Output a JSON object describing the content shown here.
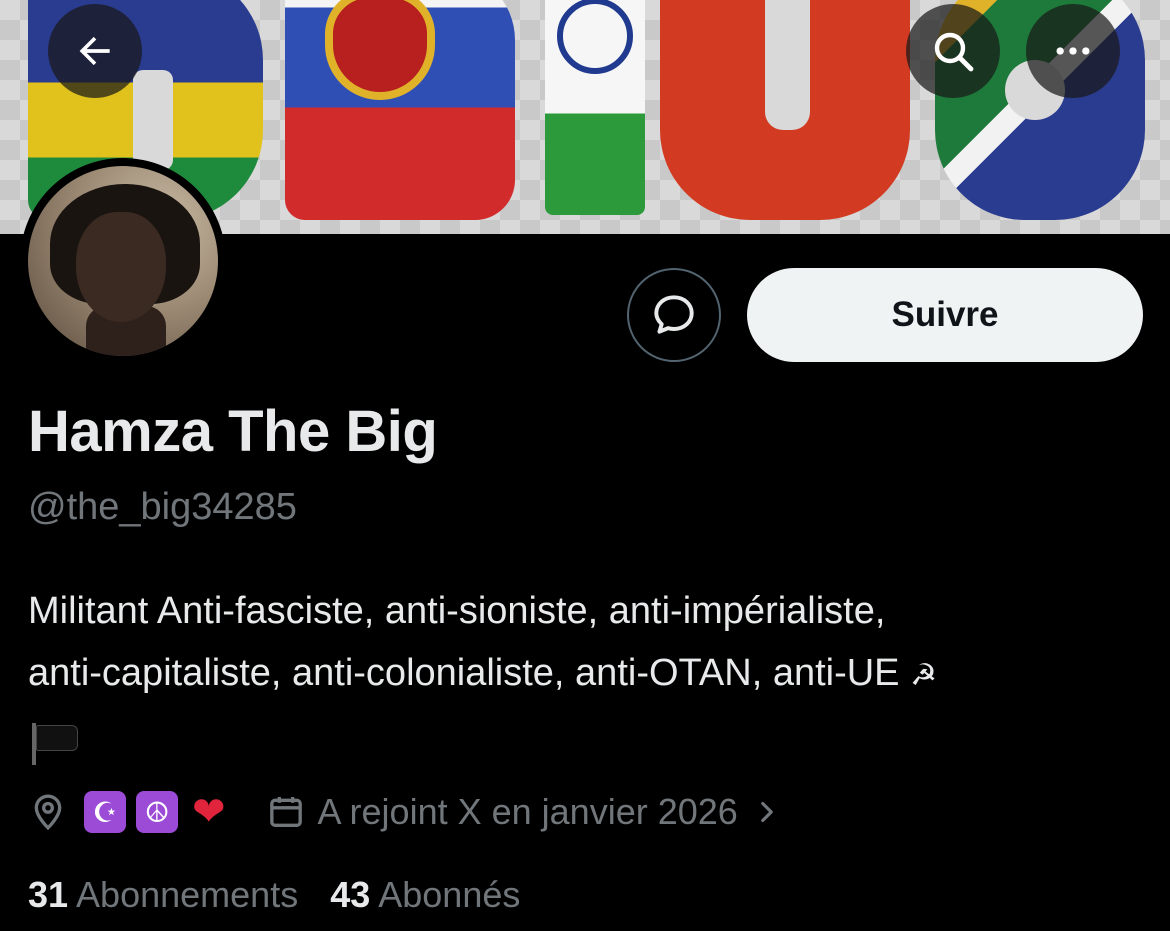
{
  "header": {
    "back_icon": "arrow-left-icon",
    "search_icon": "search-icon",
    "more_icon": "more-horizontal-icon"
  },
  "profile": {
    "display_name": "Hamza The Big",
    "handle": "@the_big34285",
    "bio_line1": "Militant Anti-fasciste, anti-sioniste, anti-impérialiste,",
    "bio_line2": "anti-capitaliste, anti-colonialiste, anti-OTAN, anti-UE",
    "bio_symbol": "☭",
    "bio_flag": "black-flag-emoji",
    "location_emojis": [
      "☪",
      "☮",
      "❤"
    ],
    "joined": "A rejoint X en janvier 2026"
  },
  "actions": {
    "follow_label": "Suivre",
    "message_icon": "message-bubble-icon"
  },
  "stats": {
    "following_count": "31",
    "following_label": "Abonnements",
    "followers_count": "43",
    "followers_label": "Abonnés"
  },
  "colors": {
    "background": "#000000",
    "primary_text": "#e7e9ea",
    "secondary_text": "#71767b",
    "follow_button_bg": "#eff3f4",
    "heart": "#e0243b",
    "emoji_purple": "#9b4bd6"
  }
}
